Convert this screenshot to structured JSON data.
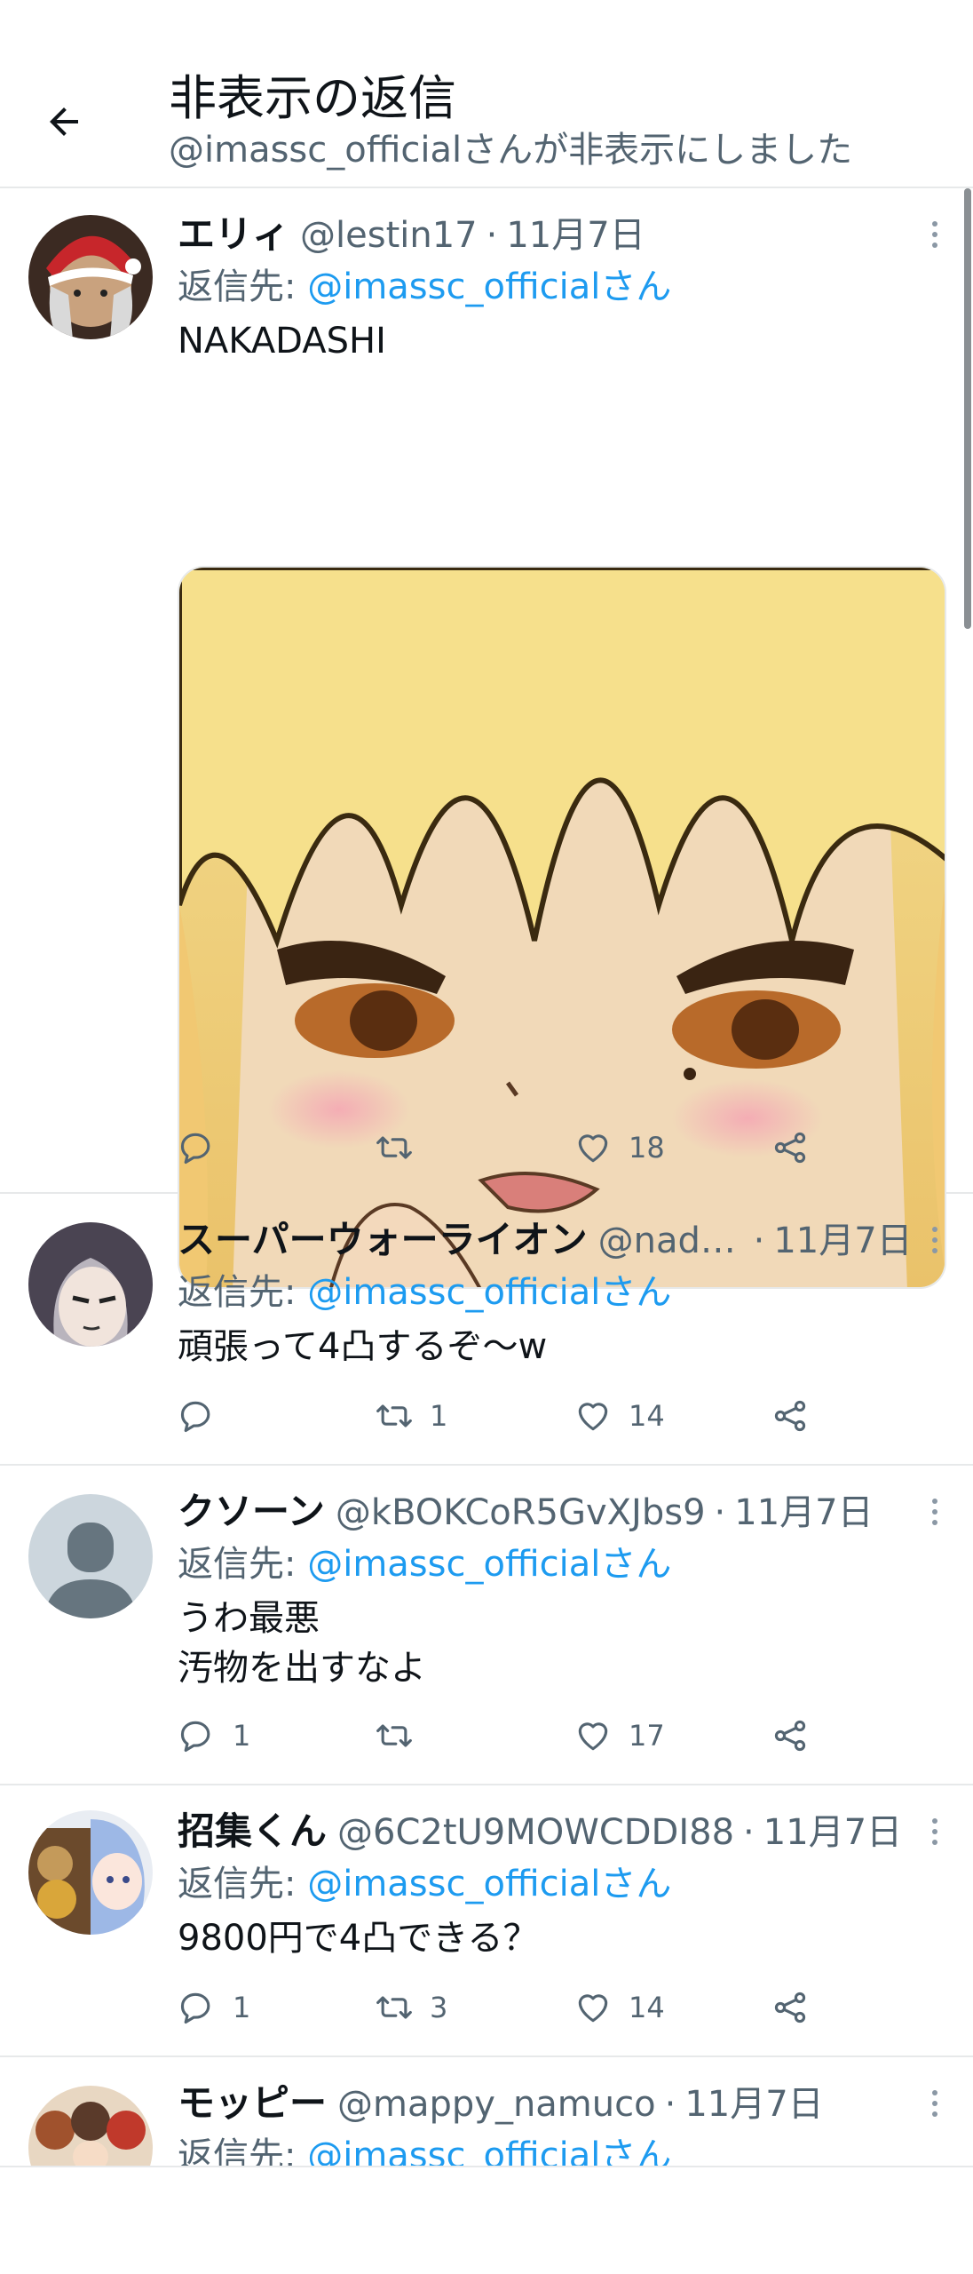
{
  "header": {
    "title": "非表示の返信",
    "subtitle": "@imassc_officialさんが非表示にしました"
  },
  "tweets": [
    {
      "name": "エリィ",
      "handle": "@lestin17",
      "date": "11月7日",
      "reply_prefix": "返信先: ",
      "reply_to": "@imassc_officialさん",
      "text": "NAKADASHI",
      "reply_count": "",
      "retweet_count": "",
      "like_count": "18"
    },
    {
      "name": "スーパーウォーライオン",
      "handle": "@nade…",
      "date": "11月7日",
      "reply_prefix": "返信先: ",
      "reply_to": "@imassc_officialさん",
      "text": "頑張って4凸するぞ～w",
      "reply_count": "",
      "retweet_count": "1",
      "like_count": "14"
    },
    {
      "name": "クソーン",
      "handle": "@kBOKCoR5GvXJbs9",
      "date": "11月7日",
      "reply_prefix": "返信先: ",
      "reply_to": "@imassc_officialさん",
      "text": "うわ最悪\n汚物を出すなよ",
      "reply_count": "1",
      "retweet_count": "",
      "like_count": "17"
    },
    {
      "name": "招集くん",
      "handle": "@6C2tU9MOWCDDI88",
      "date": "11月7日",
      "reply_prefix": "返信先: ",
      "reply_to": "@imassc_officialさん",
      "text": "9800円で4凸できる？",
      "reply_count": "1",
      "retweet_count": "3",
      "like_count": "14"
    },
    {
      "name": "モッピー",
      "handle": "@mappy_namuco",
      "date": "11月7日",
      "reply_prefix": "返信先: ",
      "reply_to": "@imassc_officialさん",
      "text": "",
      "reply_count": "",
      "retweet_count": "",
      "like_count": ""
    }
  ],
  "separator": "·",
  "icons": {
    "back": "arrow-left-icon",
    "reply": "reply-icon",
    "retweet": "retweet-icon",
    "like": "heart-icon",
    "share": "share-icon",
    "more": "more-vertical-icon"
  },
  "colors": {
    "link": "#1d9bf0",
    "secondary_text": "#536471",
    "divider": "#e7e9ea"
  }
}
